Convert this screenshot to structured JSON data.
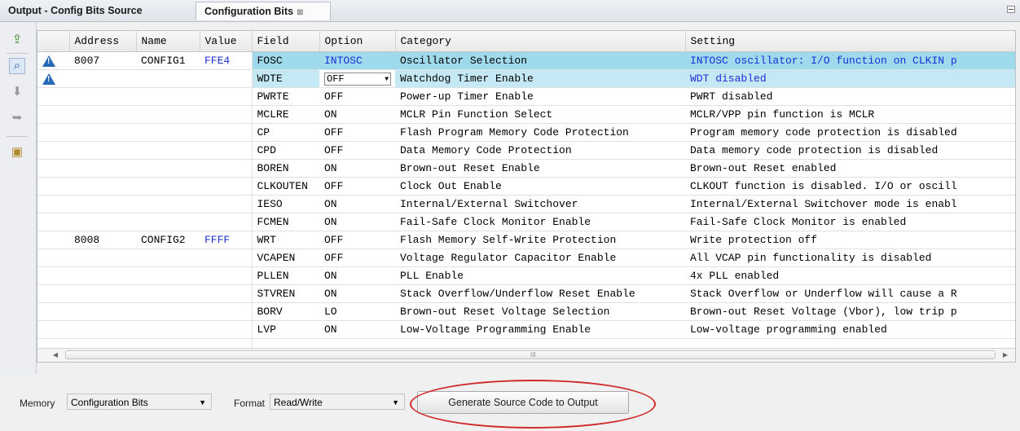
{
  "tabs": [
    {
      "label": "Output - Config Bits Source"
    },
    {
      "label": "Configuration Bits",
      "close": "⊠"
    }
  ],
  "table": {
    "headers": [
      "Address",
      "Name",
      "Value",
      "Field",
      "Option",
      "Category",
      "Setting"
    ],
    "rows": [
      {
        "warn": true,
        "address": "8007",
        "name": "CONFIG1",
        "value": "FFE4",
        "field": "FOSC",
        "option": "INTOSC",
        "category": "Oscillator Selection",
        "setting": "INTOSC oscillator: I/O function on CLKIN p"
      },
      {
        "warn": true,
        "address": "",
        "name": "",
        "value": "",
        "field": "WDTE",
        "option": "OFF",
        "category": "Watchdog Timer Enable",
        "setting": "WDT disabled"
      },
      {
        "address": "",
        "name": "",
        "value": "",
        "field": "PWRTE",
        "option": "OFF",
        "category": "Power-up Timer Enable",
        "setting": "PWRT disabled"
      },
      {
        "address": "",
        "name": "",
        "value": "",
        "field": "MCLRE",
        "option": "ON",
        "category": "MCLR Pin Function Select",
        "setting": "MCLR/VPP pin function is MCLR"
      },
      {
        "address": "",
        "name": "",
        "value": "",
        "field": "CP",
        "option": "OFF",
        "category": "Flash Program Memory Code Protection",
        "setting": "Program memory code protection is disabled"
      },
      {
        "address": "",
        "name": "",
        "value": "",
        "field": "CPD",
        "option": "OFF",
        "category": "Data Memory Code Protection",
        "setting": "Data memory code protection is disabled"
      },
      {
        "address": "",
        "name": "",
        "value": "",
        "field": "BOREN",
        "option": "ON",
        "category": "Brown-out Reset Enable",
        "setting": "Brown-out Reset enabled"
      },
      {
        "address": "",
        "name": "",
        "value": "",
        "field": "CLKOUTEN",
        "option": "OFF",
        "category": "Clock Out Enable",
        "setting": "CLKOUT function is disabled. I/O or oscill"
      },
      {
        "address": "",
        "name": "",
        "value": "",
        "field": "IESO",
        "option": "ON",
        "category": "Internal/External Switchover",
        "setting": "Internal/External Switchover mode is enabl"
      },
      {
        "address": "",
        "name": "",
        "value": "",
        "field": "FCMEN",
        "option": "ON",
        "category": "Fail-Safe Clock Monitor Enable",
        "setting": "Fail-Safe Clock Monitor is enabled"
      },
      {
        "address": "8008",
        "name": "CONFIG2",
        "value": "FFFF",
        "field": "WRT",
        "option": "OFF",
        "category": "Flash Memory Self-Write Protection",
        "setting": "Write protection off"
      },
      {
        "address": "",
        "name": "",
        "value": "",
        "field": "VCAPEN",
        "option": "OFF",
        "category": "Voltage Regulator Capacitor Enable",
        "setting": "All VCAP pin functionality is disabled"
      },
      {
        "address": "",
        "name": "",
        "value": "",
        "field": "PLLEN",
        "option": "ON",
        "category": "PLL Enable",
        "setting": "4x PLL enabled"
      },
      {
        "address": "",
        "name": "",
        "value": "",
        "field": "STVREN",
        "option": "ON",
        "category": "Stack Overflow/Underflow Reset Enable",
        "setting": "Stack Overflow or Underflow will cause a R"
      },
      {
        "address": "",
        "name": "",
        "value": "",
        "field": "BORV",
        "option": "LO",
        "category": "Brown-out Reset Voltage Selection",
        "setting": "Brown-out Reset Voltage (Vbor), low trip p"
      },
      {
        "address": "",
        "name": "",
        "value": "",
        "field": "LVP",
        "option": "ON",
        "category": "Low-Voltage Programming Enable",
        "setting": "Low-voltage programming enabled"
      }
    ]
  },
  "scrollbar": {
    "grip": "III"
  },
  "bottom": {
    "memory_label": "Memory",
    "memory_value": "Configuration Bits",
    "format_label": "Format",
    "format_value": "Read/Write",
    "generate_label": "Generate Source Code to Output"
  },
  "colors": {
    "highlight": "#9fd9ec",
    "value_blue": "#1a2ed6",
    "circle": "#d02a2a"
  }
}
